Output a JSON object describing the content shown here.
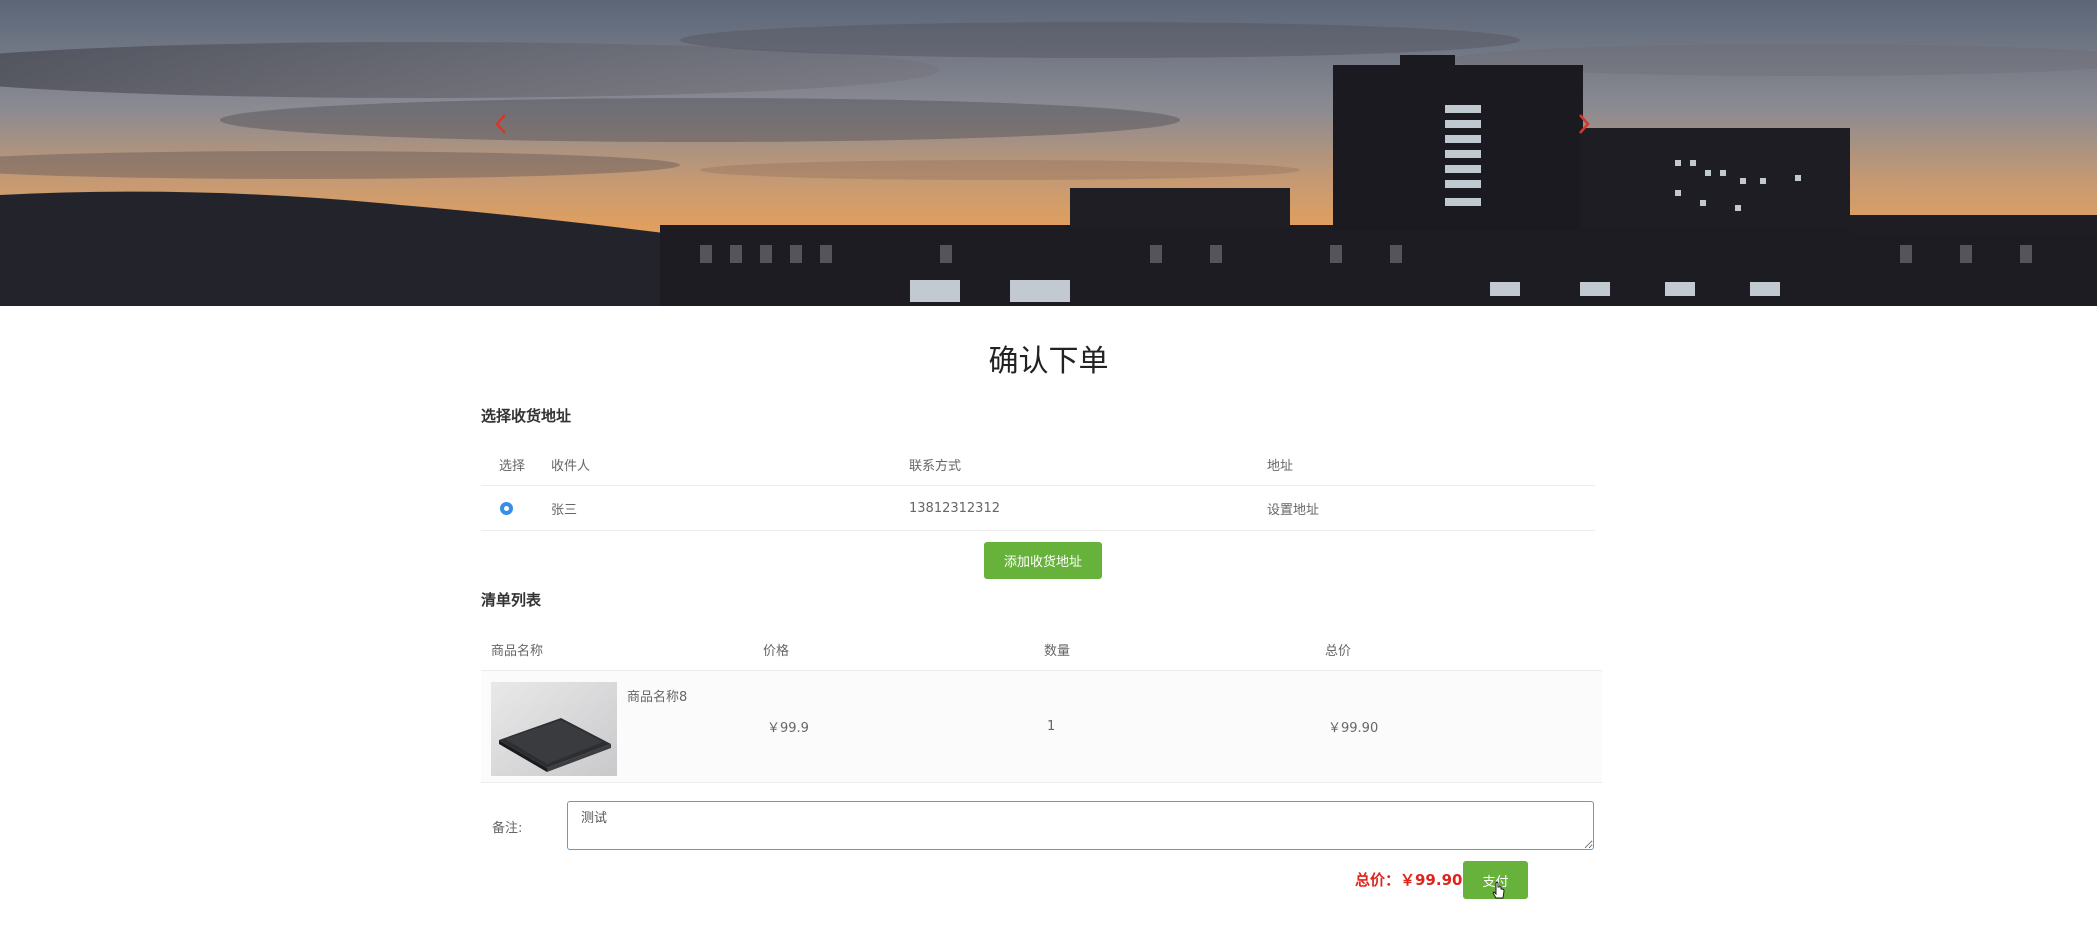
{
  "banner": {
    "prev_icon": "chevron-left-icon",
    "next_icon": "chevron-right-icon",
    "arrow_color": "#d9362b"
  },
  "page": {
    "title": "确认下单"
  },
  "address_section": {
    "title": "选择收货地址",
    "columns": [
      "选择",
      "收件人",
      "联系方式",
      "地址"
    ],
    "rows": [
      {
        "selected": true,
        "recipient": "张三",
        "phone": "13812312312",
        "address": "设置地址"
      }
    ],
    "add_button": "添加收货地址"
  },
  "list_section": {
    "title": "清单列表",
    "columns": [
      "商品名称",
      "价格",
      "数量",
      "总价"
    ],
    "items": [
      {
        "name": "商品名称8",
        "price": "￥99.9",
        "quantity": "1",
        "total": "￥99.90",
        "image": "laptop-image"
      }
    ]
  },
  "remark": {
    "label": "备注:",
    "value": "测试"
  },
  "footer": {
    "total": "总价：￥99.90",
    "pay_button": "支付"
  },
  "colors": {
    "accent_green": "#67b23a",
    "price_red": "#e0241b",
    "radio_blue": "#3a8ee6"
  }
}
